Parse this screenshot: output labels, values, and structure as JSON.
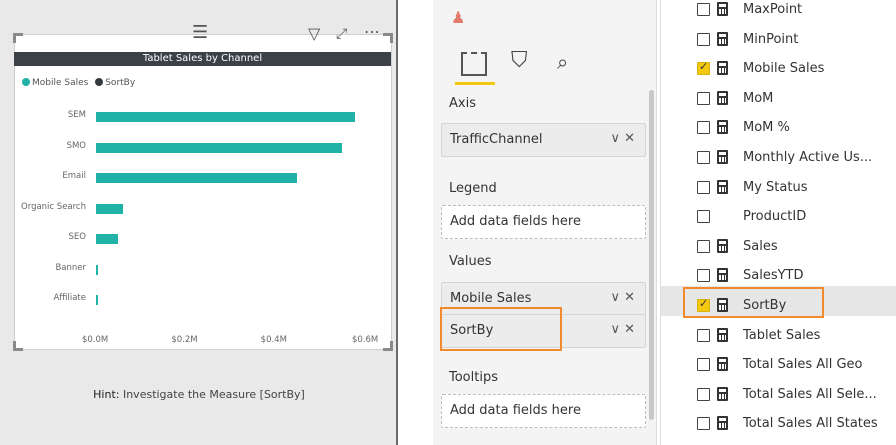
{
  "visual": {
    "title": "Tablet Sales by Channel",
    "legend": [
      {
        "label": "Mobile Sales",
        "color": "#20b2a6"
      },
      {
        "label": "SortBy",
        "color": "#333b40"
      }
    ],
    "hint_prefix": "Hint:",
    "hint_text": "Investigate the Measure [SortBy]"
  },
  "chart_data": {
    "type": "bar",
    "orientation": "horizontal",
    "categories": [
      "SEM",
      "SMO",
      "Email",
      "Organic Search",
      "SEO",
      "Banner",
      "Affiliate"
    ],
    "series": [
      {
        "name": "Mobile Sales",
        "values": [
          0.58,
          0.55,
          0.45,
          0.06,
          0.05,
          0.005,
          0.005
        ]
      }
    ],
    "x_ticks": [
      "$0.0M",
      "$0.2M",
      "$0.4M",
      "$0.6M"
    ],
    "xlim": [
      0,
      0.6
    ],
    "title": "Tablet Sales by Channel",
    "legend_position": "top-left"
  },
  "fields_pane": {
    "sections": {
      "axis": "Axis",
      "legend": "Legend",
      "values": "Values",
      "tooltips": "Tooltips"
    },
    "axis_field": "TrafficChannel",
    "legend_placeholder": "Add data fields here",
    "values_fields": [
      "Mobile Sales",
      "SortBy"
    ],
    "tooltips_placeholder": "Add data fields here",
    "chip_controls": "∨ ✕"
  },
  "fields_list": [
    {
      "name": "MaxPoint",
      "checked": false,
      "calc": true
    },
    {
      "name": "MinPoint",
      "checked": false,
      "calc": true
    },
    {
      "name": "Mobile Sales",
      "checked": true,
      "calc": true
    },
    {
      "name": "MoM",
      "checked": false,
      "calc": true
    },
    {
      "name": "MoM %",
      "checked": false,
      "calc": true
    },
    {
      "name": "Monthly Active Us...",
      "checked": false,
      "calc": true
    },
    {
      "name": "My Status",
      "checked": false,
      "calc": true
    },
    {
      "name": "ProductID",
      "checked": false,
      "calc": false
    },
    {
      "name": "Sales",
      "checked": false,
      "calc": true
    },
    {
      "name": "SalesYTD",
      "checked": false,
      "calc": true
    },
    {
      "name": "SortBy",
      "checked": true,
      "calc": true
    },
    {
      "name": "Tablet Sales",
      "checked": false,
      "calc": true
    },
    {
      "name": "Total Sales All Geo",
      "checked": false,
      "calc": true
    },
    {
      "name": "Total Sales All Sele...",
      "checked": false,
      "calc": true
    },
    {
      "name": "Total Sales All States",
      "checked": false,
      "calc": true
    }
  ],
  "colors": {
    "accent": "#f2c811",
    "highlight": "#f08a2c",
    "bar": "#20b2a6"
  }
}
